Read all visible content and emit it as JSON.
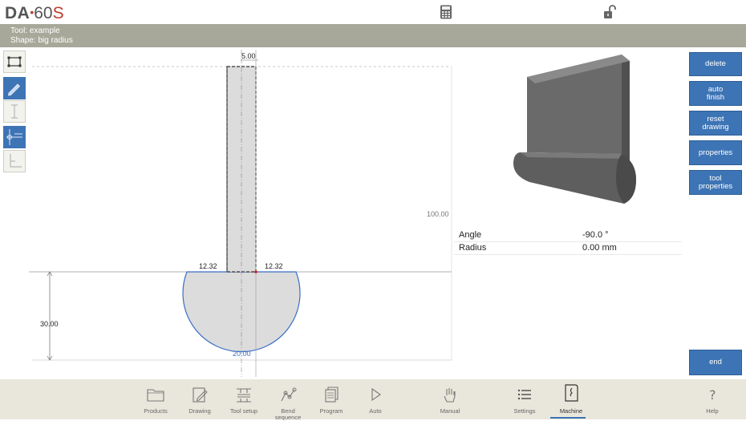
{
  "app": {
    "logo_brand": "DA",
    "logo_model": "60",
    "logo_suffix": "S"
  },
  "info": {
    "tool_line": "Tool: example",
    "shape_line": "Shape: big radius"
  },
  "drawing": {
    "dim_top": "5.00",
    "dim_right": "100.00",
    "dim_left_shoulder": "12.32",
    "dim_right_shoulder": "12.32",
    "dim_height": "30.00",
    "dim_diameter": "20.00"
  },
  "properties": [
    {
      "key": "Angle",
      "value": "-90.0 °"
    },
    {
      "key": "Radius",
      "value": "0.00 mm"
    }
  ],
  "actions": {
    "delete": "delete",
    "auto_finish_1": "auto",
    "auto_finish_2": "finish",
    "reset_drawing_1": "reset",
    "reset_drawing_2": "drawing",
    "properties": "properties",
    "tool_properties_1": "tool",
    "tool_properties_2": "properties",
    "end": "end"
  },
  "nav": {
    "products": "Products",
    "drawing": "Drawing",
    "tool_setup": "Tool setup",
    "bend_sequence_1": "Bend",
    "bend_sequence_2": "sequence",
    "program": "Program",
    "auto": "Auto",
    "manual": "Manual",
    "settings": "Settings",
    "machine": "Machine",
    "help": "Help",
    "active": "machine"
  },
  "colors": {
    "accent": "#3d74b5",
    "infobar": "#a8a89a",
    "bottombar": "#e9e7dc",
    "logo_red": "#c0392b"
  }
}
